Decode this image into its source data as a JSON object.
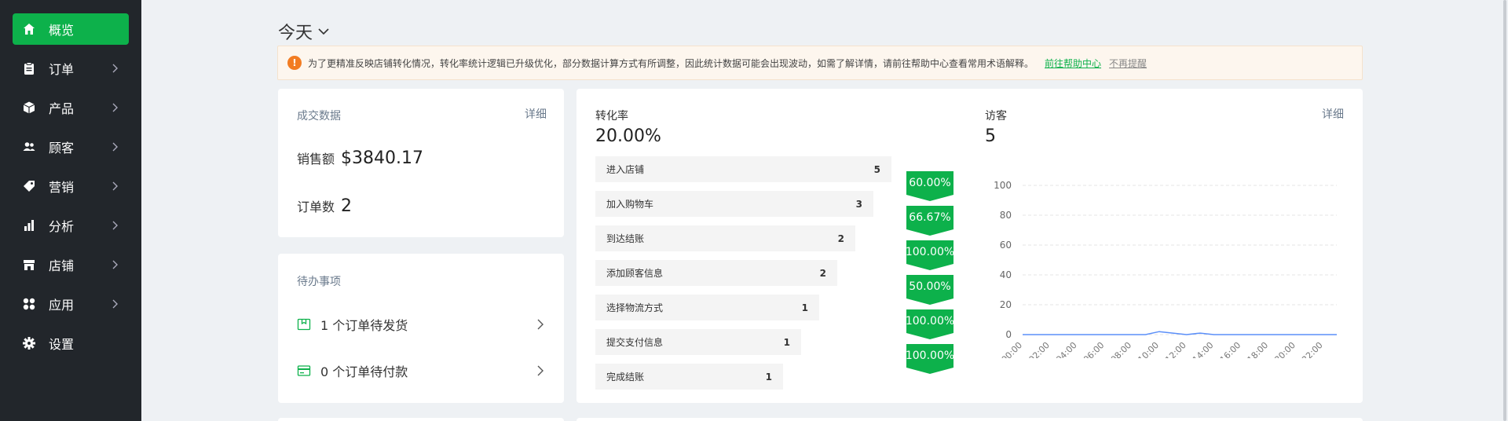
{
  "sidebar": {
    "items": [
      {
        "label": "概览",
        "icon": "home-icon",
        "active": true
      },
      {
        "label": "订单",
        "icon": "clipboard-icon"
      },
      {
        "label": "产品",
        "icon": "box-icon"
      },
      {
        "label": "顾客",
        "icon": "users-icon"
      },
      {
        "label": "营销",
        "icon": "tag-icon"
      },
      {
        "label": "分析",
        "icon": "bar-chart-icon"
      },
      {
        "label": "店铺",
        "icon": "store-icon"
      },
      {
        "label": "应用",
        "icon": "apps-icon"
      },
      {
        "label": "设置",
        "icon": "gear-icon"
      }
    ]
  },
  "header": {
    "date_range": "今天"
  },
  "notice": {
    "text": "为了更精准反映店铺转化情况，转化率统计逻辑已升级优化，部分数据计算方式有所调整，因此统计数据可能会出现波动，如需了解详情，请前往帮助中心查看常用术语解释。",
    "link": "前往帮助中心",
    "dismiss": "不再提醒"
  },
  "sales": {
    "title": "成交数据",
    "detail": "详细",
    "revenue_label": "销售额",
    "revenue_value": "$3840.17",
    "orders_label": "订单数",
    "orders_value": "2"
  },
  "todo": {
    "title": "待办事项",
    "items": [
      {
        "text": "1 个订单待发货",
        "icon": "package-icon"
      },
      {
        "text": "0 个订单待付款",
        "icon": "credit-card-icon"
      }
    ]
  },
  "conversion": {
    "title": "转化率",
    "value": "20.00%",
    "funnel": [
      {
        "label": "进入店铺",
        "count": 5
      },
      {
        "label": "加入购物车",
        "count": 3
      },
      {
        "label": "到达结账",
        "count": 2
      },
      {
        "label": "添加顾客信息",
        "count": 2
      },
      {
        "label": "选择物流方式",
        "count": 1
      },
      {
        "label": "提交支付信息",
        "count": 1
      },
      {
        "label": "完成结账",
        "count": 1
      }
    ],
    "rates": [
      "60.00%",
      "66.67%",
      "100.00%",
      "50.00%",
      "100.00%",
      "100.00%"
    ]
  },
  "visitors": {
    "title": "访客",
    "value": "5",
    "detail": "详细"
  },
  "colors": {
    "accent": "#0db14b",
    "sidebar": "#22262b",
    "warning": "#f27c22",
    "line": "#5b8ff9"
  },
  "chart_data": {
    "type": "line",
    "x": [
      "00:00",
      "01:00",
      "02:00",
      "03:00",
      "04:00",
      "05:00",
      "06:00",
      "07:00",
      "08:00",
      "09:00",
      "10:00",
      "11:00",
      "12:00",
      "13:00",
      "14:00",
      "15:00",
      "16:00",
      "17:00",
      "18:00",
      "19:00",
      "20:00",
      "21:00",
      "22:00",
      "23:00"
    ],
    "x_tick_labels": [
      "00:00",
      "02:00",
      "04:00",
      "06:00",
      "08:00",
      "10:00",
      "12:00",
      "14:00",
      "16:00",
      "18:00",
      "20:00",
      "22:00"
    ],
    "series": [
      {
        "values": [
          0,
          0,
          0,
          0,
          0,
          0,
          0,
          0,
          0,
          0,
          2,
          1,
          0,
          1,
          0,
          0,
          0,
          0,
          0,
          0,
          0,
          0,
          0,
          0
        ]
      }
    ],
    "ylim": [
      0,
      100
    ],
    "yticks": [
      0,
      20,
      40,
      60,
      80,
      100
    ],
    "grid": true
  }
}
